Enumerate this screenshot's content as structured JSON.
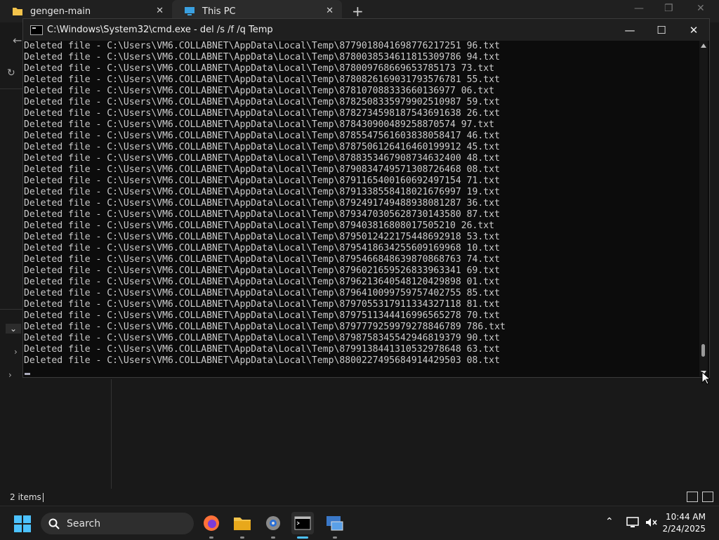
{
  "explorer": {
    "tabs": [
      {
        "label": "gengen-main"
      },
      {
        "label": "This PC"
      }
    ],
    "status_count": "2 items"
  },
  "cmd": {
    "title": "C:\\Windows\\System32\\cmd.exe - del  /s /f /q Temp",
    "lines": [
      "Deleted file - C:\\Users\\VM6.COLLABNET\\AppData\\Local\\Temp\\8779018041698776217251 96.txt",
      "Deleted file - C:\\Users\\VM6.COLLABNET\\AppData\\Local\\Temp\\8780038534611815309786 94.txt",
      "Deleted file - C:\\Users\\VM6.COLLABNET\\AppData\\Local\\Temp\\878009768669653785173 73.txt",
      "Deleted file - C:\\Users\\VM6.COLLABNET\\AppData\\Local\\Temp\\8780826169031793576781 55.txt",
      "Deleted file - C:\\Users\\VM6.COLLABNET\\AppData\\Local\\Temp\\878107088333660136977 06.txt",
      "Deleted file - C:\\Users\\VM6.COLLABNET\\AppData\\Local\\Temp\\8782508335979902510987 59.txt",
      "Deleted file - C:\\Users\\VM6.COLLABNET\\AppData\\Local\\Temp\\8782734598187543691638 26.txt",
      "Deleted file - C:\\Users\\VM6.COLLABNET\\AppData\\Local\\Temp\\878430900489258870574 97.txt",
      "Deleted file - C:\\Users\\VM6.COLLABNET\\AppData\\Local\\Temp\\8785547561603838058417 46.txt",
      "Deleted file - C:\\Users\\VM6.COLLABNET\\AppData\\Local\\Temp\\8787506126416460199912 45.txt",
      "Deleted file - C:\\Users\\VM6.COLLABNET\\AppData\\Local\\Temp\\8788353467908734632400 48.txt",
      "Deleted file - C:\\Users\\VM6.COLLABNET\\AppData\\Local\\Temp\\8790834749571308726468 08.txt",
      "Deleted file - C:\\Users\\VM6.COLLABNET\\AppData\\Local\\Temp\\8791165400160692497154 71.txt",
      "Deleted file - C:\\Users\\VM6.COLLABNET\\AppData\\Local\\Temp\\8791338558418021676997 19.txt",
      "Deleted file - C:\\Users\\VM6.COLLABNET\\AppData\\Local\\Temp\\8792491749488938081287 36.txt",
      "Deleted file - C:\\Users\\VM6.COLLABNET\\AppData\\Local\\Temp\\8793470305628730143580 87.txt",
      "Deleted file - C:\\Users\\VM6.COLLABNET\\AppData\\Local\\Temp\\879403816808017505210 26.txt",
      "Deleted file - C:\\Users\\VM6.COLLABNET\\AppData\\Local\\Temp\\8795012422175448692918 53.txt",
      "Deleted file - C:\\Users\\VM6.COLLABNET\\AppData\\Local\\Temp\\8795418634255609169968 10.txt",
      "Deleted file - C:\\Users\\VM6.COLLABNET\\AppData\\Local\\Temp\\8795466848639870868763 74.txt",
      "Deleted file - C:\\Users\\VM6.COLLABNET\\AppData\\Local\\Temp\\8796021659526833963341 69.txt",
      "Deleted file - C:\\Users\\VM6.COLLABNET\\AppData\\Local\\Temp\\8796213640548120429898 01.txt",
      "Deleted file - C:\\Users\\VM6.COLLABNET\\AppData\\Local\\Temp\\8796410099759757402755 85.txt",
      "Deleted file - C:\\Users\\VM6.COLLABNET\\AppData\\Local\\Temp\\8797055317911334327118 81.txt",
      "Deleted file - C:\\Users\\VM6.COLLABNET\\AppData\\Local\\Temp\\8797511344416996565278 70.txt",
      "Deleted file - C:\\Users\\VM6.COLLABNET\\AppData\\Local\\Temp\\8797779259979278846789 786.txt",
      "Deleted file - C:\\Users\\VM6.COLLABNET\\AppData\\Local\\Temp\\8798758345542946819379 90.txt",
      "Deleted file - C:\\Users\\VM6.COLLABNET\\AppData\\Local\\Temp\\8799138441310532978648 63.txt",
      "Deleted file - C:\\Users\\VM6.COLLABNET\\AppData\\Local\\Temp\\8800227495684914429503 08.txt"
    ]
  },
  "taskbar": {
    "search_label": "Search",
    "time": "10:44 AM",
    "date": "2/24/2025",
    "accent": "#4cc2ff"
  }
}
